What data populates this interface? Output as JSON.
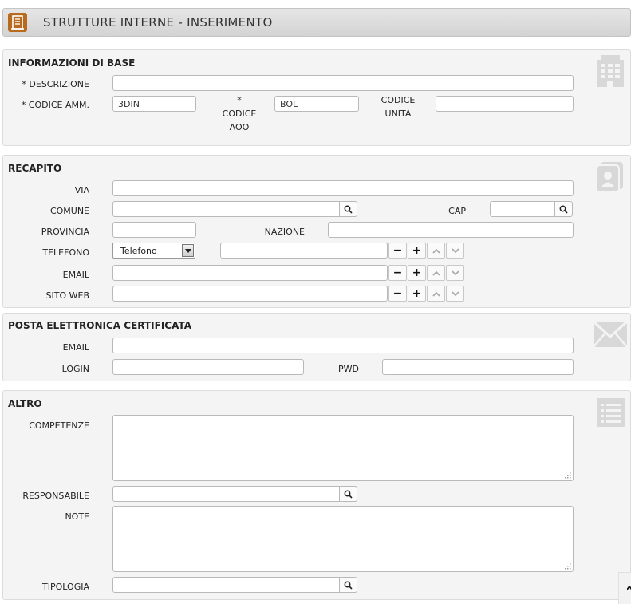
{
  "header": {
    "title": "STRUTTURE INTERNE - INSERIMENTO",
    "icon": "building-document-icon"
  },
  "colors": {
    "accent": "#b86a1e",
    "panel_bg": "#f4f4f4",
    "panel_border": "#dcdcdc",
    "section_icon": "#d8d8d8"
  },
  "info_base": {
    "title": "INFORMAZIONI DI BASE",
    "icon": "building-icon",
    "descrizione_label": "* DESCRIZIONE",
    "descrizione_value": "",
    "codice_amm_label": "* CODICE AMM.",
    "codice_amm_value": "3DIN",
    "codice_aoo_star": "*",
    "codice_aoo_label_1": "CODICE",
    "codice_aoo_label_2": "AOO",
    "codice_aoo_value": "BOL",
    "codice_unita_label_1": "CODICE",
    "codice_unita_label_2": "UNITÀ",
    "codice_unita_value": ""
  },
  "recapito": {
    "title": "RECAPITO",
    "icon": "contact-card-icon",
    "via_label": "VIA",
    "comune_label": "COMUNE",
    "cap_label": "CAP",
    "provincia_label": "PROVINCIA",
    "nazione_label": "NAZIONE",
    "telefono_label": "TELEFONO",
    "telefono_type": "Telefono",
    "email_label": "EMAIL",
    "sito_web_label": "SITO WEB",
    "minus": "−",
    "plus": "+"
  },
  "pec": {
    "title": "POSTA ELETTRONICA CERTIFICATA",
    "icon": "envelope-icon",
    "email_label": "EMAIL",
    "login_label": "LOGIN",
    "pwd_label": "PWD"
  },
  "altro": {
    "title": "ALTRO",
    "icon": "list-icon",
    "competenze_label": "COMPETENZE",
    "responsabile_label": "RESPONSABILE",
    "note_label": "NOTE",
    "tipologia_label": "TIPOLOGIA"
  }
}
